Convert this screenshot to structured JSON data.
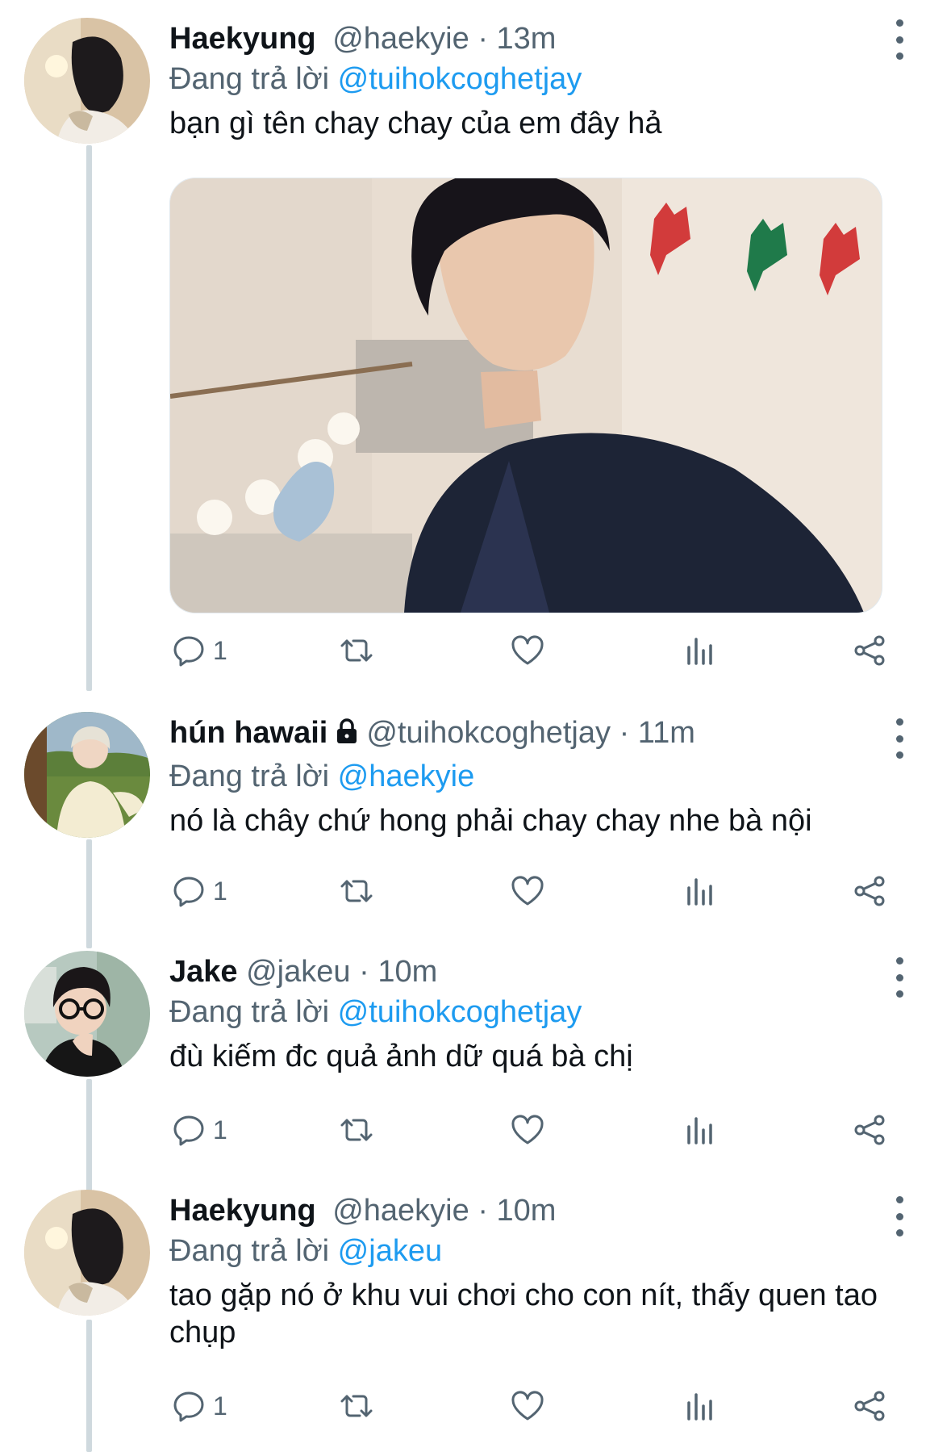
{
  "colors": {
    "text": "#0f1419",
    "secondary": "#536471",
    "accent": "#1d9bf0",
    "thread_line": "#cfd9de"
  },
  "tweets": [
    {
      "name": "Haekyung",
      "handle": "@haekyie",
      "separator": "·",
      "time": "13m",
      "reply_prefix": "Đang trả lời",
      "reply_to": "@tuihokcoghetjay",
      "text": "bạn gì tên chay chay của em đây hả",
      "has_media": true,
      "reply_count": "1",
      "avatar_icon": "avatar-photo"
    },
    {
      "name": "hún hawaii",
      "protected_icon": "lock-icon",
      "handle": "@tuihokcoghetjay",
      "separator": "·",
      "time": "11m",
      "reply_prefix": "Đang trả lời",
      "reply_to": "@haekyie",
      "text": "nó là chây chứ hong phải chay chay nhe bà nội",
      "reply_count": "1",
      "avatar_icon": "avatar-photo"
    },
    {
      "name": "Jake",
      "handle": "@jakeu",
      "separator": "·",
      "time": "10m",
      "reply_prefix": "Đang trả lời",
      "reply_to": "@tuihokcoghetjay",
      "text": "đù kiếm đc quả ảnh dữ quá bà chị",
      "reply_count": "1",
      "avatar_icon": "avatar-photo"
    },
    {
      "name": "Haekyung",
      "handle": "@haekyie",
      "separator": "·",
      "time": "10m",
      "reply_prefix": "Đang trả lời",
      "reply_to": "@jakeu",
      "text": "tao gặp nó ở khu vui chơi cho con nít, thấy quen tao chụp",
      "reply_count": "1",
      "avatar_icon": "avatar-photo"
    }
  ],
  "action_icons": [
    "reply-icon",
    "retweet-icon",
    "like-icon",
    "views-icon",
    "share-icon"
  ]
}
